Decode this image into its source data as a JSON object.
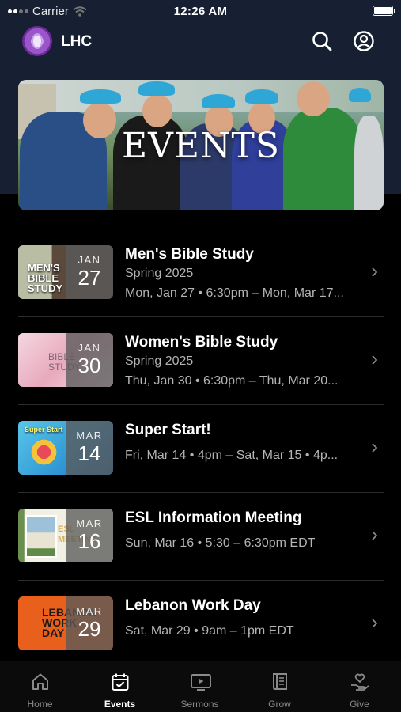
{
  "status_bar": {
    "carrier": "Carrier",
    "time": "12:26 AM"
  },
  "header": {
    "app_title": "LHC"
  },
  "hero": {
    "title": "EVENTS"
  },
  "events": [
    {
      "title": "Men's Bible Study",
      "subtitle": "Spring 2025",
      "date": "Mon, Jan 27 • 6:30pm – Mon, Mar 17...",
      "month": "JAN",
      "day": "27",
      "thumb_text": "MEN'S BIBLE STUDY"
    },
    {
      "title": "Women's Bible Study",
      "subtitle": "Spring 2025",
      "date": "Thu, Jan 30 • 6:30pm – Thu, Mar 20...",
      "month": "JAN",
      "day": "30",
      "thumb_text": "BIBLE STUDY"
    },
    {
      "title": "Super Start!",
      "subtitle": "",
      "date": "Fri, Mar 14 • 4pm – Sat, Mar 15 • 4p...",
      "month": "MAR",
      "day": "14",
      "thumb_text": "Super Start"
    },
    {
      "title": "ESL Information Meeting",
      "subtitle": "",
      "date": "Sun, Mar 16 • 5:30 – 6:30pm EDT",
      "month": "MAR",
      "day": "16",
      "thumb_text": "ESL MEETING"
    },
    {
      "title": "Lebanon Work Day",
      "subtitle": "",
      "date": "Sat, Mar 29 • 9am – 1pm EDT",
      "month": "MAR",
      "day": "29",
      "thumb_text": "LEBANON WORK DAY"
    }
  ],
  "tabs": [
    {
      "label": "Home",
      "icon": "home-icon"
    },
    {
      "label": "Events",
      "icon": "calendar-icon",
      "active": true
    },
    {
      "label": "Sermons",
      "icon": "video-icon"
    },
    {
      "label": "Grow",
      "icon": "book-icon"
    },
    {
      "label": "Give",
      "icon": "give-icon"
    }
  ],
  "colors": {
    "header_bg": "#172032",
    "background": "#000000",
    "accent": "#ffffff",
    "muted_text": "#b4b4b4"
  }
}
